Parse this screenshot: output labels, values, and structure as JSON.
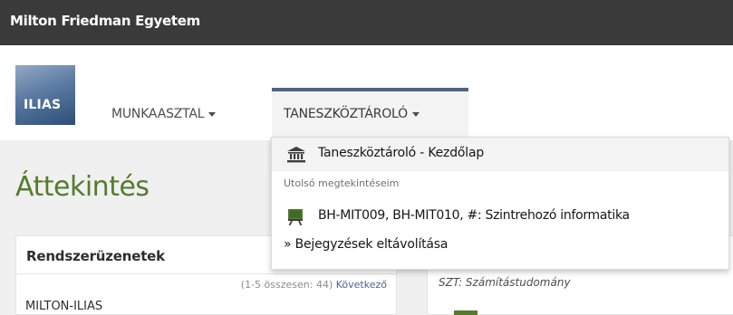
{
  "topbar": {
    "title": "Milton Friedman Egyetem"
  },
  "header": {
    "logo_text": "ILIAS",
    "nav": [
      {
        "label": "MUNKAASZTAL"
      },
      {
        "label": "TANESZKÖZTÁROLÓ"
      }
    ]
  },
  "dropdown": {
    "home_label": "Taneszköztároló - Kezdőlap",
    "recent_heading": "Utolsó megtekintéseim",
    "recent_items": [
      {
        "label": "BH-MIT009, BH-MIT010, #: Szintrehozó informatika",
        "icon": "whiteboard-icon"
      }
    ],
    "remove_label": "» Bejegyzések eltávolítása"
  },
  "main": {
    "title": "Áttekintés",
    "system_messages": {
      "heading": "Rendszerüzenetek",
      "count_text": "(1-5 összesen: 44)",
      "next_label": "Következő",
      "first_item": "MILTON-ILIAS"
    },
    "right_panel": {
      "subtitle": "SZT: Számítástudomány"
    }
  },
  "colors": {
    "topbar": "#3a3a3a",
    "accent_green": "#557b2e",
    "link_blue": "#4c6586"
  }
}
